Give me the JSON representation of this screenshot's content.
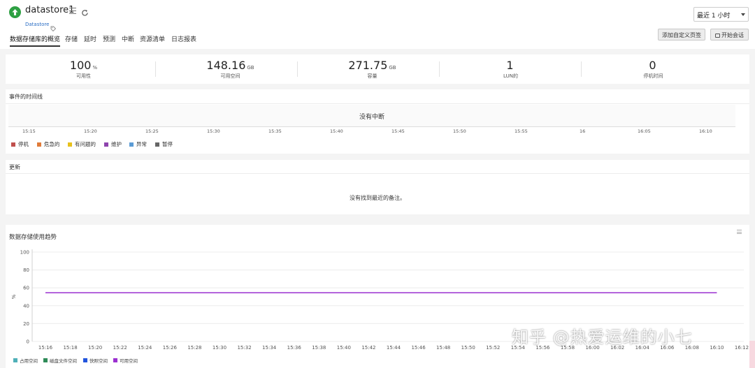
{
  "header": {
    "title": "datastore1",
    "type_label": "Datastore",
    "time_range": "最近 1 小时",
    "custom_page_button": "添加自定义页签",
    "chat_button": "开始会话"
  },
  "tabs": [
    {
      "label": "数据存储库的概览",
      "active": true
    },
    {
      "label": "存储"
    },
    {
      "label": "延时"
    },
    {
      "label": "预测"
    },
    {
      "label": "中断"
    },
    {
      "label": "资源清单"
    },
    {
      "label": "日志报表"
    }
  ],
  "kpis": [
    {
      "value": "100",
      "unit": "%",
      "label": "可用性"
    },
    {
      "value": "148.16",
      "unit": "GB",
      "label": "可用空间"
    },
    {
      "value": "271.75",
      "unit": "GB",
      "label": "容量"
    },
    {
      "value": "1",
      "unit": "",
      "label": "LUN的"
    },
    {
      "value": "0",
      "unit": "",
      "label": "停机时间"
    }
  ],
  "events": {
    "title": "事件的时间线",
    "no_interrupt": "没有中断",
    "times": [
      "15:15",
      "15:20",
      "15:25",
      "15:30",
      "15:35",
      "15:40",
      "15:45",
      "15:50",
      "15:55",
      "16",
      "16:05",
      "16:10"
    ],
    "legend": [
      {
        "label": "停机",
        "color": "#c0504d"
      },
      {
        "label": "危急的",
        "color": "#e07b39"
      },
      {
        "label": "有问题的",
        "color": "#e8c11c"
      },
      {
        "label": "维护",
        "color": "#8e44ad"
      },
      {
        "label": "异常",
        "color": "#5b9bd5"
      },
      {
        "label": "暂停",
        "color": "#666666"
      }
    ]
  },
  "updates": {
    "title": "更新",
    "empty": "没有找到最近的备注。"
  },
  "trend": {
    "title": "数据存储使用趋势",
    "watermark": "知乎 @热爱运维的小七"
  },
  "chart_data": {
    "type": "line",
    "title": "数据存储使用趋势",
    "ylabel": "%",
    "ylim": [
      0,
      100
    ],
    "yticks": [
      0,
      20,
      40,
      60,
      80,
      100
    ],
    "x": [
      "15:16",
      "15:18",
      "15:20",
      "15:22",
      "15:24",
      "15:26",
      "15:28",
      "15:30",
      "15:32",
      "15:34",
      "15:36",
      "15:38",
      "15:40",
      "15:42",
      "15:44",
      "15:46",
      "15:48",
      "15:50",
      "15:52",
      "15:54",
      "15:56",
      "15:58",
      "16:00",
      "16:02",
      "16:04",
      "16:06",
      "16:08",
      "16:10",
      "16:12"
    ],
    "series": [
      {
        "name": "占用空间",
        "color": "#4fb0b8",
        "values": []
      },
      {
        "name": "磁盘文件空间",
        "color": "#2e8b57",
        "values": []
      },
      {
        "name": "快照空间",
        "color": "#2255dd",
        "values": []
      },
      {
        "name": "可用空间",
        "color": "#9b30d0",
        "values": [
          54.5,
          54.5,
          54.5,
          54.5,
          54.5,
          54.5,
          54.5,
          54.5,
          54.5,
          54.5,
          54.5,
          54.5,
          54.5,
          54.5,
          54.5,
          54.5,
          54.5,
          54.5,
          54.5,
          54.5,
          54.5,
          54.5,
          54.5,
          54.5,
          54.5,
          54.5,
          54.5,
          54.5
        ]
      }
    ],
    "legend_position": "bottom-left",
    "grid": true
  }
}
